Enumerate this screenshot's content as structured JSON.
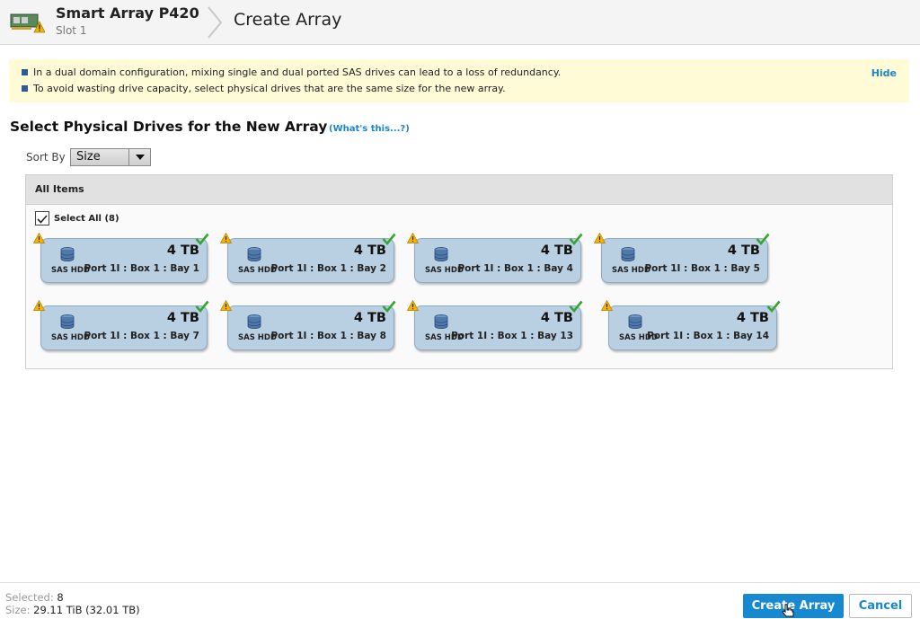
{
  "header": {
    "controller_name": "Smart Array P420",
    "controller_slot": "Slot 1",
    "page_title": "Create Array",
    "controller_icon": "controller-warning-icon"
  },
  "notice": {
    "lines": [
      "In a dual domain configuration, mixing single and dual ported SAS drives can lead to a loss of redundancy.",
      "To avoid wasting drive capacity, select physical drives that are the same size for the new array."
    ],
    "hide_label": "Hide"
  },
  "section": {
    "title": "Select Physical Drives for the New Array",
    "help_link": "(What's this...?)"
  },
  "sort": {
    "label": "Sort By",
    "selected": "Size"
  },
  "panel": {
    "header": "All Items",
    "select_all_label": "Select All (8)",
    "select_all_checked": true
  },
  "drives": [
    {
      "type": "SAS HDD",
      "size": "4 TB",
      "location": "Port 1I : Box 1 : Bay 1",
      "selected": true,
      "warning": true
    },
    {
      "type": "SAS HDD",
      "size": "4 TB",
      "location": "Port 1I : Box 1 : Bay 2",
      "selected": true,
      "warning": true
    },
    {
      "type": "SAS HDD",
      "size": "4 TB",
      "location": "Port 1I : Box 1 : Bay 4",
      "selected": true,
      "warning": true
    },
    {
      "type": "SAS HDD",
      "size": "4 TB",
      "location": "Port 1I : Box 1 : Bay 5",
      "selected": true,
      "warning": true
    },
    {
      "type": "SAS HDD",
      "size": "4 TB",
      "location": "Port 1I : Box 1 : Bay 7",
      "selected": true,
      "warning": true
    },
    {
      "type": "SAS HDD",
      "size": "4 TB",
      "location": "Port 1I : Box 1 : Bay 8",
      "selected": true,
      "warning": true
    },
    {
      "type": "SAS HDD",
      "size": "4 TB",
      "location": "Port 1I : Box 1 : Bay 13",
      "selected": true,
      "warning": true
    },
    {
      "type": "SAS HDD",
      "size": "4 TB",
      "location": "Port 1I : Box 1 : Bay 14",
      "selected": true,
      "warning": true
    }
  ],
  "footer": {
    "selected_label": "Selected:",
    "selected_value": "8",
    "size_label": "Size:",
    "size_value": "29.11 TiB (32.01 TB)",
    "create_button": "Create Array",
    "cancel_button": "Cancel"
  },
  "colors": {
    "accent": "#1789d0",
    "tile_fill": "#b9cfe2",
    "notice_bg": "#fffbd6",
    "check": "#3aa335",
    "warning": "#f5b400"
  }
}
